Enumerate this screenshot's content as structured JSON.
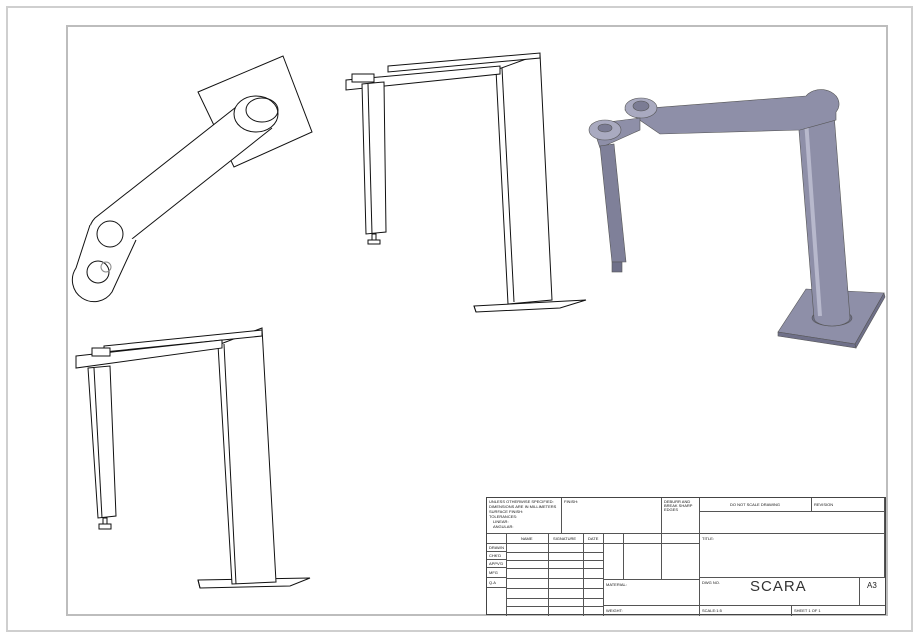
{
  "drawing": {
    "title": "SCARA",
    "size": "A3"
  },
  "title_block": {
    "notes": [
      "UNLESS OTHERWISE SPECIFIED:",
      "DIMENSIONS ARE IN MILLIMETERS",
      "SURFACE FINISH:",
      "TOLERANCES:",
      "LINEAR:",
      "ANGULAR:"
    ],
    "finish_label": "FINISH:",
    "deburr_label": "DEBURR AND BREAK SHARP EDGES",
    "do_not_scale": "DO NOT SCALE DRAWING",
    "revision_label": "REVISION",
    "col_name": "NAME",
    "col_signature": "SIGNATURE",
    "col_date": "DATE",
    "rows": [
      "DRAWN",
      "CHK'D",
      "APPV'D",
      "MFG",
      "Q.A"
    ],
    "material_label": "MATERIAL:",
    "weight_label": "WEIGHT:",
    "title_label": "TITLE:",
    "dwg_no_label": "DWG NO.",
    "scale_label": "SCALE:1:5",
    "sheet_label": "SHEET 1 OF 1"
  },
  "colors": {
    "line": "#111111",
    "shaded_body": "#8e8fa8",
    "shaded_dark": "#6f7089",
    "shaded_light": "#a9aac0"
  }
}
